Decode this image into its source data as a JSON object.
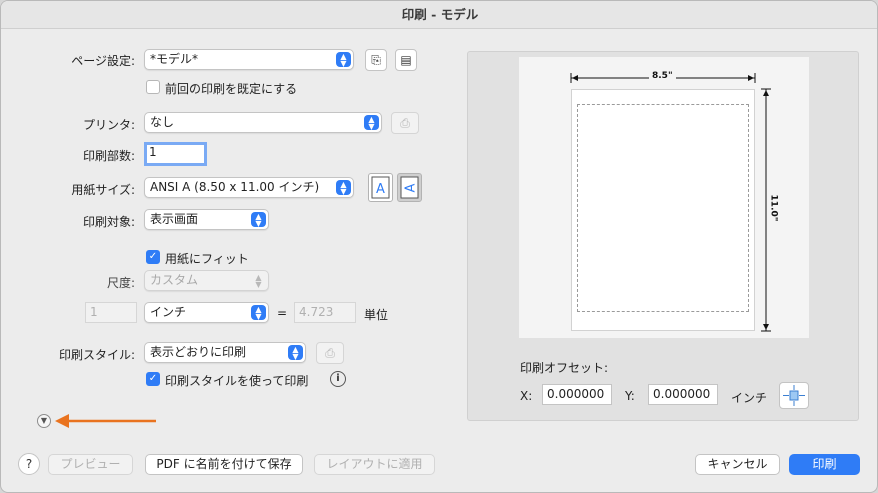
{
  "window": {
    "title": "印刷 - モデル"
  },
  "page_setup": {
    "label": "ページ設定:",
    "value": "*モデル*",
    "use_previous_label": "前回の印刷を既定にする",
    "use_previous_checked": false
  },
  "printer": {
    "label": "プリンタ:",
    "value": "なし"
  },
  "copies": {
    "label": "印刷部数:",
    "value": "1"
  },
  "paper_size": {
    "label": "用紙サイズ:",
    "value": "ANSI A (8.50 x 11.00 インチ)",
    "orientation": "landscape"
  },
  "print_area": {
    "label": "印刷対象:",
    "value": "表示画面"
  },
  "scale": {
    "fit_label": "用紙にフィット",
    "fit_checked": true,
    "label": "尺度:",
    "value": "カスタム",
    "left_value": "1",
    "units": "インチ",
    "equals": "=",
    "right_value": "4.723",
    "unit_label": "単位"
  },
  "plot_style": {
    "label": "印刷スタイル:",
    "value": "表示どおりに印刷",
    "use_label": "印刷スタイルを使って印刷",
    "use_checked": true
  },
  "preview": {
    "width_label": "8.5\"",
    "height_label": "11.0\""
  },
  "offset": {
    "label": "印刷オフセット:",
    "x_label": "X:",
    "x_value": "0.000000",
    "y_label": "Y:",
    "y_value": "0.000000",
    "units": "インチ"
  },
  "buttons": {
    "help": "?",
    "preview": "プレビュー",
    "save_pdf": "PDF に名前を付けて保存",
    "apply_layout": "レイアウトに適用",
    "cancel": "キャンセル",
    "print": "印刷"
  },
  "colors": {
    "accent": "#2f7cf6",
    "arrow": "#e9731f"
  }
}
